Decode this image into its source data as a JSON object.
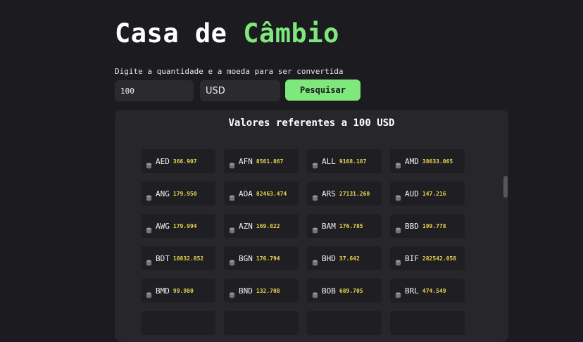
{
  "header": {
    "title_main": "Casa de",
    "title_accent": "Câmbio"
  },
  "search": {
    "hint": "Digite a quantidade e a moeda para ser convertida",
    "amount": "100",
    "currency": "USD",
    "button_label": "Pesquisar"
  },
  "results": {
    "title": "Valores referentes a 100 USD",
    "items": [
      {
        "code": "AED",
        "value": "366.907"
      },
      {
        "code": "AFN",
        "value": "8561.867"
      },
      {
        "code": "ALL",
        "value": "9168.187"
      },
      {
        "code": "AMD",
        "value": "38633.065"
      },
      {
        "code": "ANG",
        "value": "179.950"
      },
      {
        "code": "AOA",
        "value": "82463.474"
      },
      {
        "code": "ARS",
        "value": "27131.260"
      },
      {
        "code": "AUD",
        "value": "147.216"
      },
      {
        "code": "AWG",
        "value": "179.994"
      },
      {
        "code": "AZN",
        "value": "169.822"
      },
      {
        "code": "BAM",
        "value": "176.785"
      },
      {
        "code": "BBD",
        "value": "199.778"
      },
      {
        "code": "BDT",
        "value": "10832.852"
      },
      {
        "code": "BGN",
        "value": "176.794"
      },
      {
        "code": "BHD",
        "value": "37.642"
      },
      {
        "code": "BIF",
        "value": "282542.058"
      },
      {
        "code": "BMD",
        "value": "99.980"
      },
      {
        "code": "BND",
        "value": "132.708"
      },
      {
        "code": "BOB",
        "value": "689.705"
      },
      {
        "code": "BRL",
        "value": "474.549"
      },
      {
        "code": "",
        "value": ""
      },
      {
        "code": "",
        "value": ""
      },
      {
        "code": "",
        "value": ""
      },
      {
        "code": "",
        "value": ""
      }
    ]
  },
  "icons": {
    "coin": "coin-stack-icon"
  },
  "colors": {
    "background": "#1b1b20",
    "accent": "#7ee87d",
    "value_text": "#e8d44d",
    "panel": "#27272b",
    "card": "#1f1f23"
  }
}
